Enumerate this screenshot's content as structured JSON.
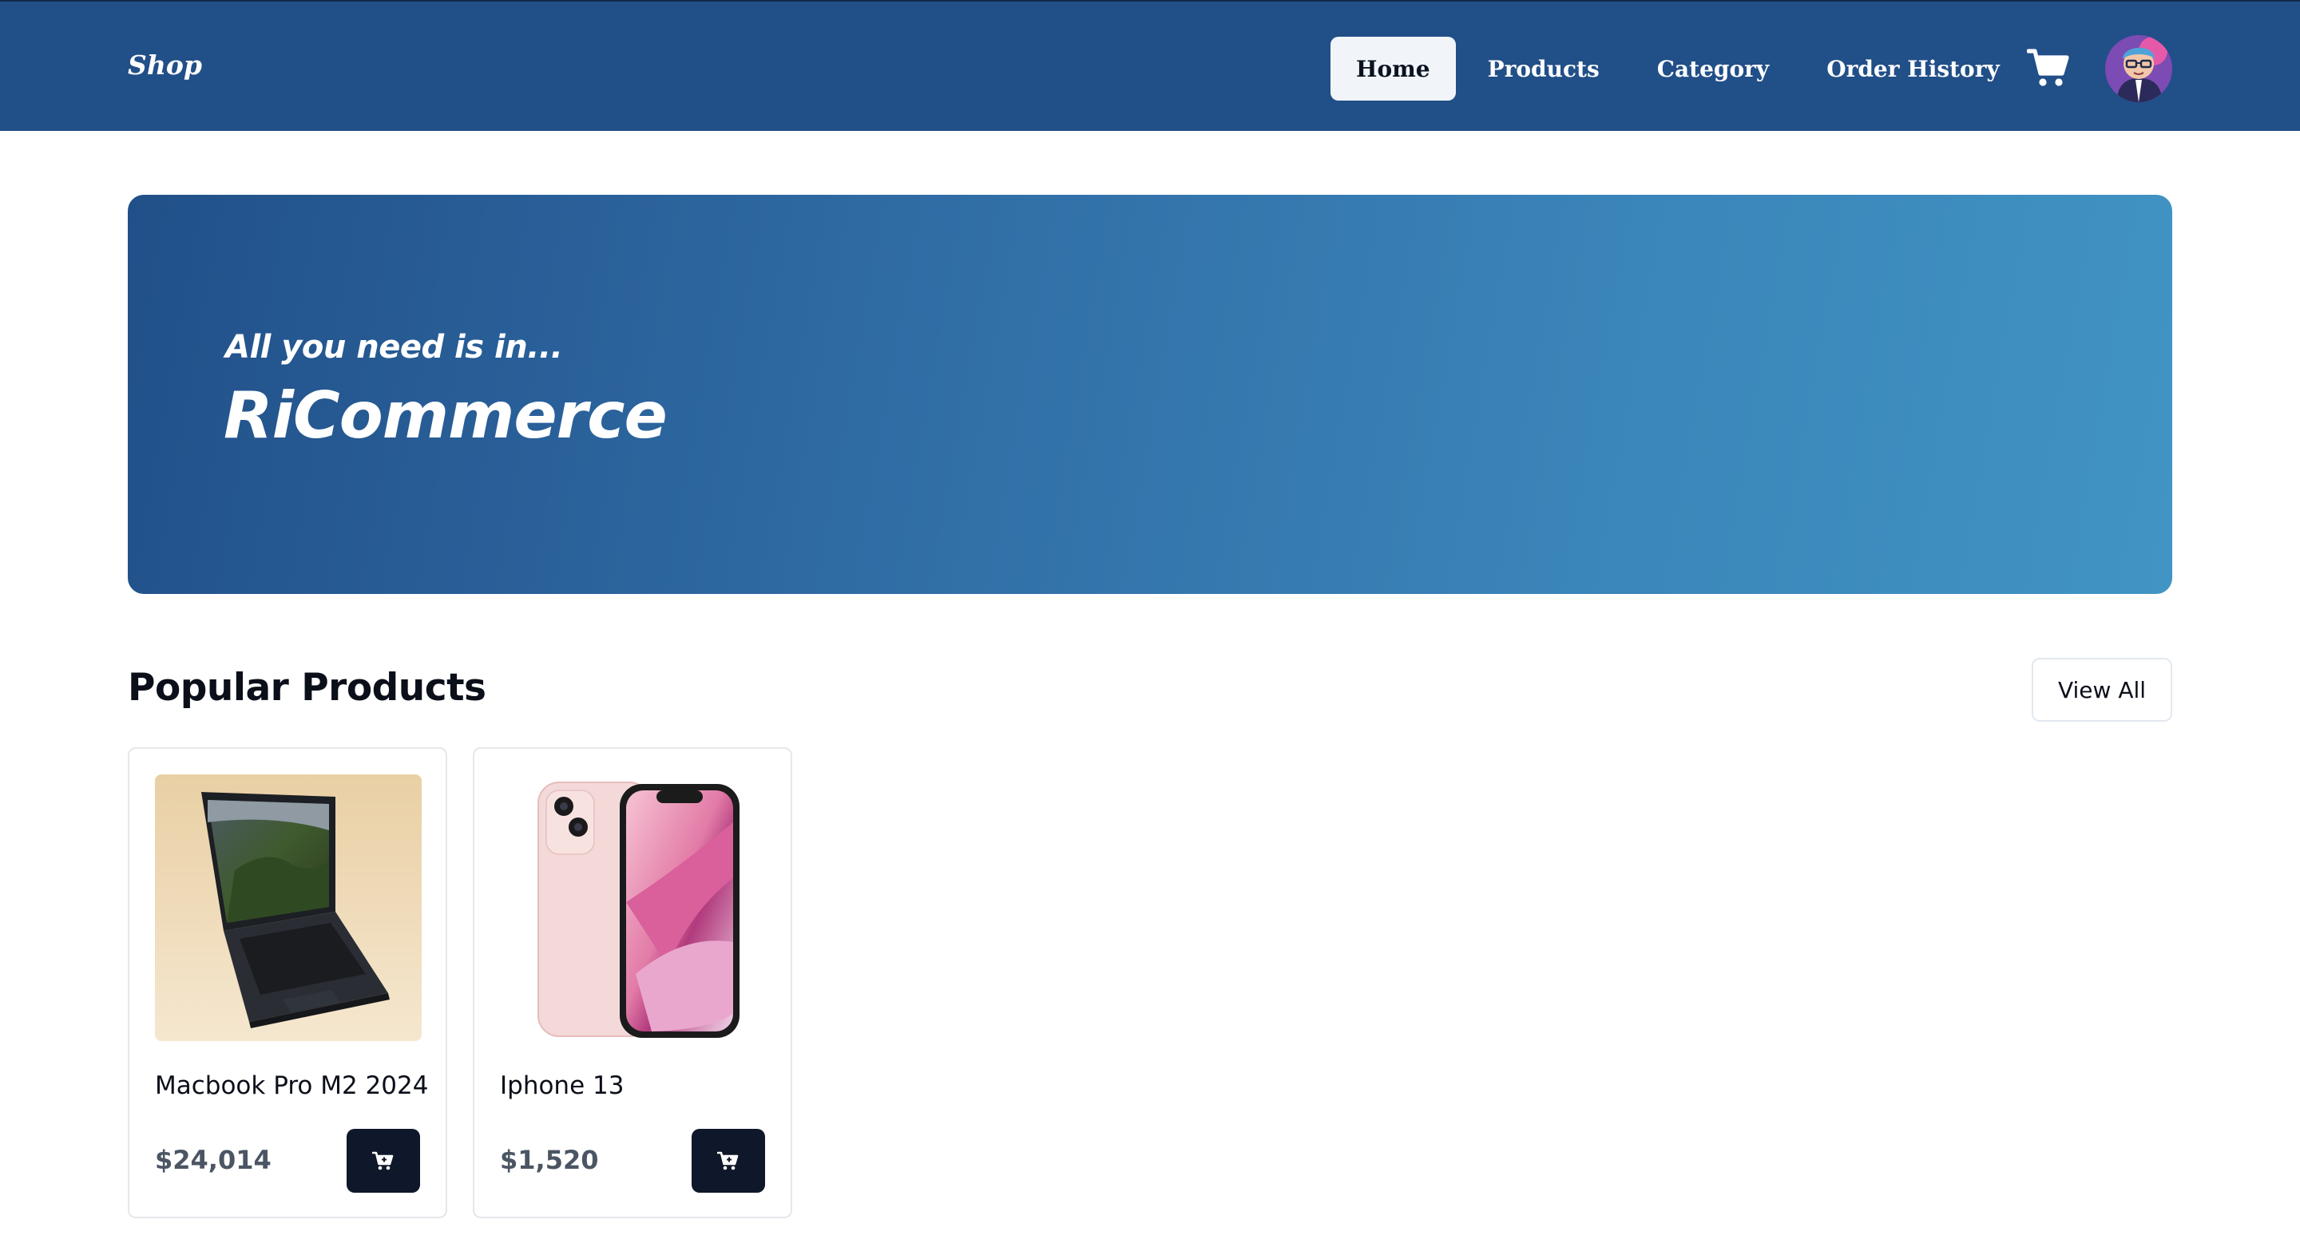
{
  "brand": "Shop",
  "nav": {
    "items": [
      {
        "label": "Home",
        "active": true
      },
      {
        "label": "Products",
        "active": false
      },
      {
        "label": "Category",
        "active": false
      },
      {
        "label": "Order History",
        "active": false
      }
    ],
    "cart_icon": "shopping-cart-icon",
    "avatar_icon": "user-avatar"
  },
  "hero": {
    "subtitle": "All you need is in...",
    "title": "RiCommerce"
  },
  "popular": {
    "title": "Popular Products",
    "view_all_label": "View All",
    "products": [
      {
        "name": "Macbook Pro M2 2024",
        "price": "$24,014",
        "image": "laptop-photo"
      },
      {
        "name": "Iphone 13",
        "price": "$1,520",
        "image": "phone-photo"
      }
    ],
    "add_to_cart_icon": "cart-plus-icon"
  },
  "colors": {
    "navbar": "#214f88",
    "hero_start": "#215089",
    "hero_end": "#4194c4",
    "button_dark": "#0f172a",
    "price": "#4b5563"
  }
}
